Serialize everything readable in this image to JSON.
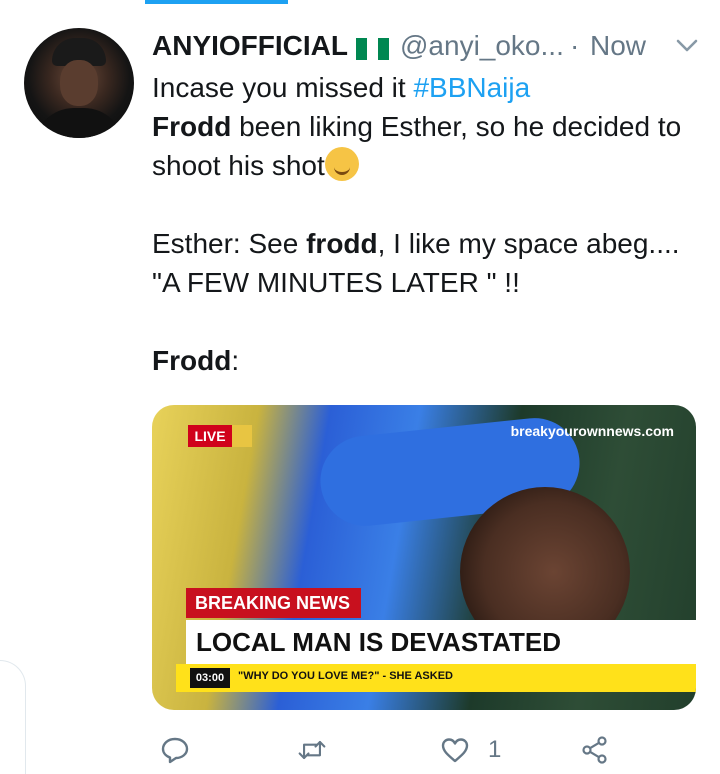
{
  "tweet": {
    "display_name": "ANYIOFFICIAL",
    "handle": "@anyi_oko...",
    "separator": "·",
    "timestamp": "Now",
    "line1_text": "Incase you missed it ",
    "hashtag": "#BBNaija",
    "line2_bold": "Frodd",
    "line2_rest": " been liking Esther, so he decided to shoot his shot",
    "line3_start": "Esther: See ",
    "line3_bold": "frodd",
    "line3_rest": ", I like my space abeg....",
    "line4": "\"A FEW MINUTES LATER \" !!",
    "line5_bold": "Frodd",
    "line5_rest": ":",
    "emoji_name": "smirking-face-emoji",
    "flag_colors": [
      "#008751",
      "#ffffff",
      "#008751"
    ]
  },
  "media": {
    "live_label": "LIVE",
    "source_url": "breakyourownnews.com",
    "breaking_label": "BREAKING NEWS",
    "headline": "LOCAL MAN IS DEVASTATED",
    "ticker_time": "03:00",
    "ticker_text": "\"WHY DO YOU LOVE ME?\" - SHE ASKED"
  },
  "actions": {
    "reply_icon": "reply-icon",
    "retweet_icon": "retweet-icon",
    "like_icon": "like-icon",
    "like_count": "1",
    "share_icon": "share-icon"
  },
  "colors": {
    "accent": "#1da1f2",
    "secondary_text": "#657786",
    "breaking_red": "#c8101e",
    "ticker_yellow": "#ffe11a"
  }
}
